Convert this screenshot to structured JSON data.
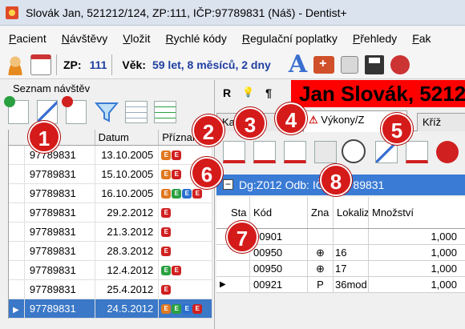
{
  "window": {
    "title": "Slovák Jan, 521212/124, ZP:111, IČP:97789831 (Náš) - Dentist+"
  },
  "menu": [
    {
      "label": "Pacient",
      "u": "P"
    },
    {
      "label": "Návštěvy",
      "u": "N"
    },
    {
      "label": "Vložit",
      "u": "V"
    },
    {
      "label": "Rychlé kódy",
      "u": "R"
    },
    {
      "label": "Regulační poplatky",
      "u": "R"
    },
    {
      "label": "Přehledy",
      "u": "P"
    },
    {
      "label": "Fak",
      "u": "F"
    }
  ],
  "toolbar": {
    "zp_label": "ZP:",
    "zp_value": "111",
    "vek_label": "Věk:",
    "vek_value": "59 let, 8 měsíců, 2 dny",
    "icons": [
      "user-icon",
      "calendar-icon",
      "font-icon",
      "first-aid-case-icon",
      "lock-icon",
      "save-icon",
      "settings-icon"
    ]
  },
  "visits": {
    "caption": "Seznam návštěv",
    "columns": [
      "",
      "Datum",
      "Příznak"
    ],
    "rows": [
      {
        "id": "97789831",
        "date": "13.10.2005",
        "flags": [
          "o",
          "r"
        ],
        "selected": false
      },
      {
        "id": "97789831",
        "date": "15.10.2005",
        "flags": [
          "o",
          "r"
        ],
        "selected": false
      },
      {
        "id": "97789831",
        "date": "16.10.2005",
        "flags": [
          "o",
          "g",
          "b",
          "r"
        ],
        "selected": false
      },
      {
        "id": "97789831",
        "date": "29.2.2012",
        "flags": [
          "r"
        ],
        "selected": false
      },
      {
        "id": "97789831",
        "date": "21.3.2012",
        "flags": [
          "r"
        ],
        "selected": false
      },
      {
        "id": "97789831",
        "date": "28.3.2012",
        "flags": [
          "r"
        ],
        "selected": false
      },
      {
        "id": "97789831",
        "date": "12.4.2012",
        "flags": [
          "g",
          "r"
        ],
        "selected": false
      },
      {
        "id": "97789831",
        "date": "25.4.2012",
        "flags": [
          "r"
        ],
        "selected": false
      },
      {
        "id": "97789831",
        "date": "24.5.2012",
        "flags": [
          "o",
          "g",
          "b",
          "r"
        ],
        "selected": true
      }
    ]
  },
  "patient_banner": "Jan Slovák, 5212",
  "right_letters": [
    "R",
    "💡",
    "¶"
  ],
  "tabs": [
    {
      "label": "Karta",
      "active": false
    },
    {
      "label": "Výkony/Z",
      "active": true
    },
    {
      "label": "Kříž",
      "active": false
    }
  ],
  "group_bar": "Dg:Z012 Odb:    IČP:97789831",
  "procedures": {
    "columns": [
      "Sta",
      "Kód",
      "Zna",
      "Lokaliz",
      "Množství"
    ],
    "rows": [
      {
        "code": "00901",
        "mark": "",
        "loc": "",
        "qty": "1,000",
        "current": false
      },
      {
        "code": "00950",
        "mark": "⊕",
        "loc": "16",
        "qty": "1,000",
        "current": false
      },
      {
        "code": "00950",
        "mark": "⊕",
        "loc": "17",
        "qty": "1,000",
        "current": false
      },
      {
        "code": "00921",
        "mark": "P",
        "loc": "36mod",
        "qty": "1,000",
        "current": true
      }
    ]
  },
  "callouts": [
    "1",
    "2",
    "3",
    "4",
    "5",
    "6",
    "7",
    "8"
  ],
  "colors": {
    "accent": "#3a7bd5",
    "banner": "#ff0000",
    "callout": "#d51a1a",
    "selected_row": "#3b78c7"
  }
}
